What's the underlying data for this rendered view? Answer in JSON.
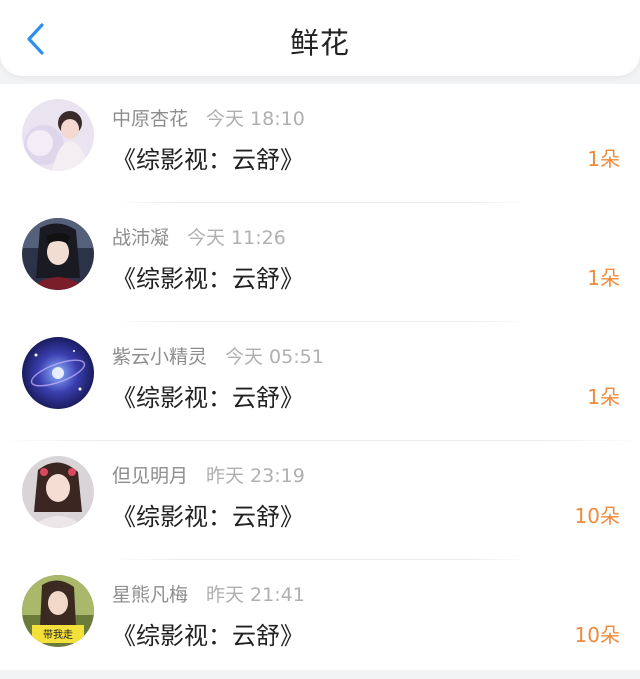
{
  "header": {
    "title": "鲜花",
    "back_icon": "chevron-left-icon",
    "accent": "#2f8ff0"
  },
  "items": [
    {
      "name": "中原杏花",
      "time": "今天 18:10",
      "book": "《综影视：云舒》",
      "count": "1朵"
    },
    {
      "name": "战沛凝",
      "time": "今天 11:26",
      "book": "《综影视：云舒》",
      "count": "1朵"
    },
    {
      "name": "紫云小精灵",
      "time": "今天 05:51",
      "book": "《综影视：云舒》",
      "count": "1朵"
    },
    {
      "name": "但见明月",
      "time": "昨天 23:19",
      "book": "《综影视：云舒》",
      "count": "10朵"
    },
    {
      "name": "星熊凡梅",
      "time": "昨天 21:41",
      "book": "《综影视：云舒》",
      "count": "10朵",
      "avatar_badge": "带我走"
    }
  ],
  "colors": {
    "count": "#ef8a3c",
    "name": "#8e8e8e",
    "time": "#b0b0b0",
    "book": "#222222"
  }
}
